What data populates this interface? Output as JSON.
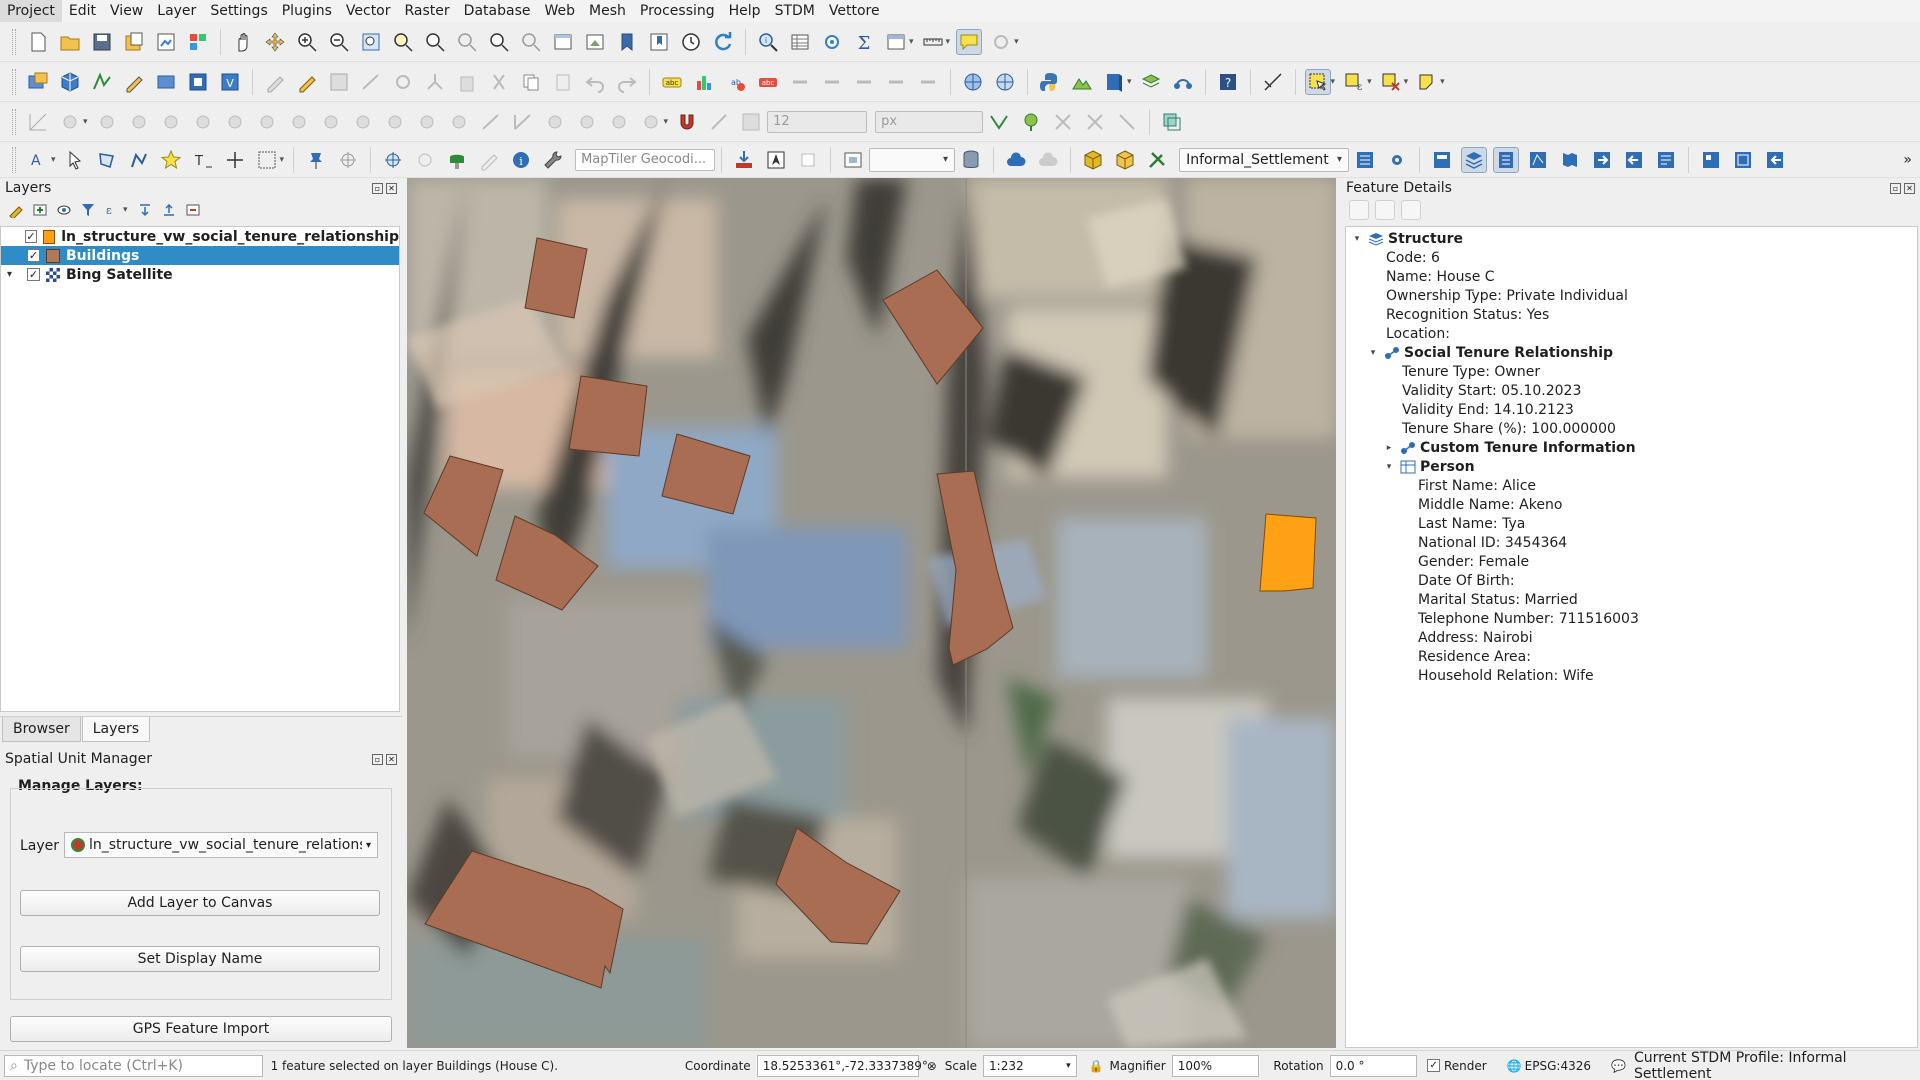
{
  "menubar": [
    "Project",
    "Edit",
    "View",
    "Layer",
    "Settings",
    "Plugins",
    "Vector",
    "Raster",
    "Database",
    "Web",
    "Mesh",
    "Processing",
    "Help",
    "STDM",
    "Vettore"
  ],
  "toolbar": {
    "font_size_value": "12",
    "font_unit_value": "px",
    "geocoder_placeholder": "MapTiler Geocodi...",
    "profile_combo": "Informal_Settlement"
  },
  "layers_dock": {
    "title": "Layers",
    "layers": [
      {
        "name": "ln_structure_vw_social_tenure_relationship",
        "checked": true,
        "color": "#ff9e17",
        "selected": false,
        "expander": ""
      },
      {
        "name": "Buildings",
        "checked": true,
        "color": "#b07a5a",
        "selected": true,
        "expander": ""
      },
      {
        "name": "Bing Satellite",
        "checked": true,
        "color": "",
        "selected": false,
        "expander": "▾"
      }
    ]
  },
  "dock_tabs": {
    "browser": "Browser",
    "layers": "Layers"
  },
  "spatial_unit_manager": {
    "title": "Spatial Unit Manager",
    "heading": "Manage Layers:",
    "layer_label": "Layer",
    "layer_value": "ln_structure_vw_social_tenure_relations",
    "add_layer_button": "Add Layer to Canvas",
    "set_display_name_button": "Set Display Name",
    "gps_import_button": "GPS Feature Import"
  },
  "feature_details": {
    "title": "Feature Details",
    "rows": [
      {
        "level": 0,
        "exp": "▾",
        "icon": "layers",
        "text": "Structure",
        "bold": true
      },
      {
        "level": 1,
        "exp": "",
        "icon": "",
        "text": "Code: 6",
        "bold": false
      },
      {
        "level": 1,
        "exp": "",
        "icon": "",
        "text": "Name: House C",
        "bold": false
      },
      {
        "level": 1,
        "exp": "",
        "icon": "",
        "text": "Ownership Type: Private Individual",
        "bold": false
      },
      {
        "level": 1,
        "exp": "",
        "icon": "",
        "text": "Recognition Status: Yes",
        "bold": false
      },
      {
        "level": 1,
        "exp": "",
        "icon": "",
        "text": "Location:",
        "bold": false
      },
      {
        "level": 1,
        "exp": "▾",
        "icon": "str",
        "text": "Social Tenure Relationship",
        "bold": true
      },
      {
        "level": 2,
        "exp": "",
        "icon": "",
        "text": "Tenure Type: Owner",
        "bold": false
      },
      {
        "level": 2,
        "exp": "",
        "icon": "",
        "text": "Validity Start: 05.10.2023",
        "bold": false
      },
      {
        "level": 2,
        "exp": "",
        "icon": "",
        "text": "Validity End: 14.10.2123",
        "bold": false
      },
      {
        "level": 2,
        "exp": "",
        "icon": "",
        "text": "Tenure Share (%): 100.000000",
        "bold": false
      },
      {
        "level": 2,
        "exp": "▸",
        "icon": "str",
        "text": "Custom Tenure Information",
        "bold": true
      },
      {
        "level": 2,
        "exp": "▾",
        "icon": "table",
        "text": "Person",
        "bold": true
      },
      {
        "level": 3,
        "exp": "",
        "icon": "",
        "text": "First Name: Alice",
        "bold": false
      },
      {
        "level": 3,
        "exp": "",
        "icon": "",
        "text": "Middle Name: Akeno",
        "bold": false
      },
      {
        "level": 3,
        "exp": "",
        "icon": "",
        "text": "Last Name: Tya",
        "bold": false
      },
      {
        "level": 3,
        "exp": "",
        "icon": "",
        "text": "National ID: 3454364",
        "bold": false
      },
      {
        "level": 3,
        "exp": "",
        "icon": "",
        "text": "Gender: Female",
        "bold": false
      },
      {
        "level": 3,
        "exp": "",
        "icon": "",
        "text": "Date Of Birth:",
        "bold": false
      },
      {
        "level": 3,
        "exp": "",
        "icon": "",
        "text": "Marital Status: Married",
        "bold": false
      },
      {
        "level": 3,
        "exp": "",
        "icon": "",
        "text": "Telephone Number: 711516003",
        "bold": false
      },
      {
        "level": 3,
        "exp": "",
        "icon": "",
        "text": "Address: Nairobi",
        "bold": false
      },
      {
        "level": 3,
        "exp": "",
        "icon": "",
        "text": "Residence Area:",
        "bold": false
      },
      {
        "level": 3,
        "exp": "",
        "icon": "",
        "text": "Household Relation: Wife",
        "bold": false
      }
    ]
  },
  "statusbar": {
    "locate_placeholder": "Type to locate (Ctrl+K)",
    "message": "1 feature selected on layer Buildings (House C).",
    "coordinate_label": "Coordinate",
    "coordinate_value": "18.5253361°,-72.3337389°",
    "scale_label": "Scale",
    "scale_value": "1:232",
    "magnifier_label": "Magnifier",
    "magnifier_value": "100%",
    "rotation_label": "Rotation",
    "rotation_value": "0.0 °",
    "render_label": "Render",
    "crs": "EPSG:4326",
    "profile": "Current STDM Profile: Informal Settlement"
  },
  "colors": {
    "building_fill": "#a86d52",
    "selected_fill": "#ffa114",
    "selection_highlight": "#308cc6"
  }
}
